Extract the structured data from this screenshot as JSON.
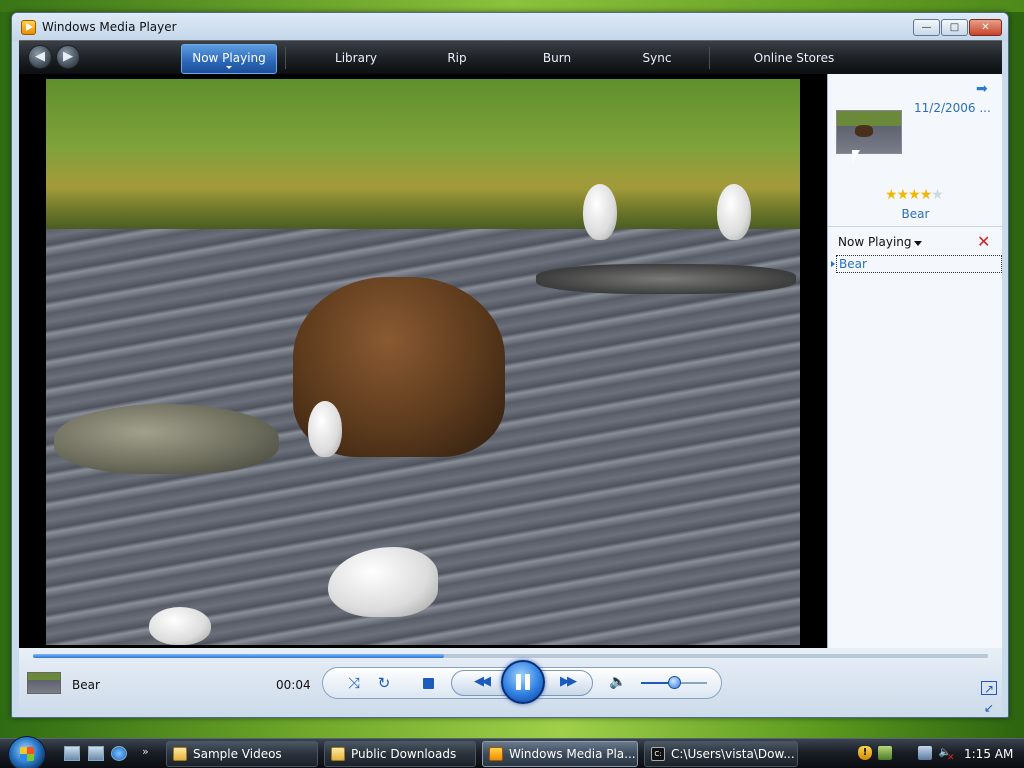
{
  "window": {
    "title": "Windows Media Player",
    "controls": {
      "minimize": "—",
      "maximize": "□",
      "close": "✕"
    }
  },
  "nav": {
    "back_icon": "back-arrow-icon",
    "forward_icon": "forward-arrow-icon",
    "tabs": [
      {
        "label": "Now Playing",
        "active": true
      },
      {
        "label": "Library",
        "active": false
      },
      {
        "label": "Rip",
        "active": false
      },
      {
        "label": "Burn",
        "active": false
      },
      {
        "label": "Sync",
        "active": false
      },
      {
        "label": "Online Stores",
        "active": false
      }
    ]
  },
  "video": {
    "scene": "bear-and-gulls-in-river"
  },
  "pane": {
    "album_date": "11/2/2006 ...",
    "rating": 4,
    "rating_max": 5,
    "album_name": "Bear",
    "list_title": "Now Playing",
    "items": [
      {
        "title": "Bear",
        "selected": true
      }
    ]
  },
  "player": {
    "now_playing_title": "Bear",
    "elapsed": "00:04",
    "progress": 0.43,
    "volume": 0.5,
    "icons": [
      "shuffle-icon",
      "repeat-icon",
      "stop-icon",
      "rewind-icon",
      "pause-icon",
      "fast-forward-icon",
      "speaker-icon"
    ]
  },
  "taskbar": {
    "tasks": [
      {
        "label": "Sample Videos",
        "icon": "folder-icon",
        "active": false
      },
      {
        "label": "Public Downloads",
        "icon": "folder-icon",
        "active": false
      },
      {
        "label": "Windows Media Pla...",
        "icon": "media-player-icon",
        "active": true
      },
      {
        "label": "C:\\Users\\vista\\Dow...",
        "icon": "command-prompt-icon",
        "active": false
      }
    ],
    "clock": "1:15 AM"
  },
  "colors": {
    "accent": "#2a74d8",
    "link": "#2a6fbf",
    "nav_bg": "#1c2024",
    "window_frame": "#c9dcee"
  }
}
